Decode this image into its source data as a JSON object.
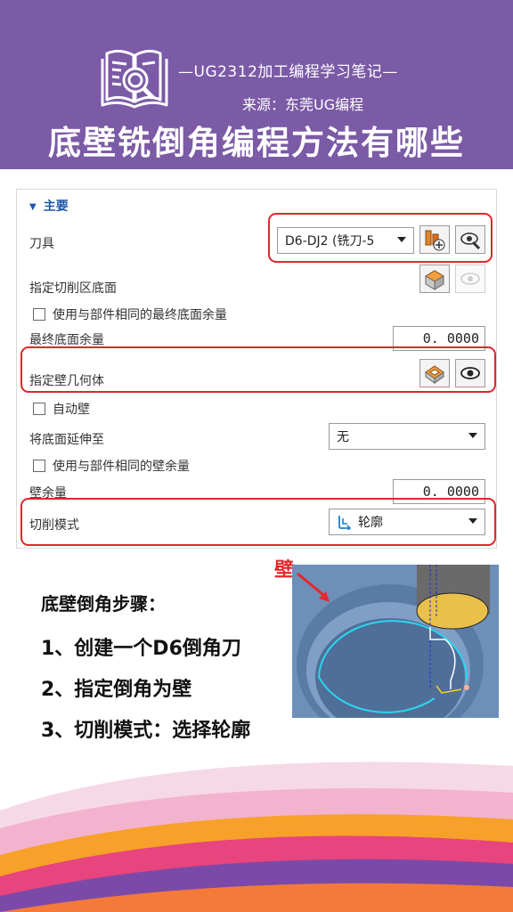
{
  "header": {
    "subtitle": "—UG2312加工编程学习笔记—",
    "source": "来源：东莞UG编程",
    "title": "底壁铣倒角编程方法有哪些"
  },
  "panel": {
    "section": "主要",
    "tool_label": "刀具",
    "tool_value": "D6-DJ2 (铣刀-5",
    "floor_label": "指定切削区底面",
    "floor_stock_cb": "使用与部件相同的最终底面余量",
    "floor_stock_label": "最终底面余量",
    "floor_stock_value": "0. 0000",
    "wall_geom_label": "指定壁几何体",
    "auto_wall_cb": "自动壁",
    "extend_label": "将底面延伸至",
    "extend_value": "无",
    "wall_stock_cb": "使用与部件相同的壁余量",
    "wall_stock_label": "壁余量",
    "wall_stock_value": "0. 0000",
    "cut_mode_label": "切削模式",
    "cut_mode_value": "轮廓"
  },
  "steps": {
    "title": "底壁倒角步骤：",
    "s1": "1、创建一个D6倒角刀",
    "s2": "2、指定倒角为壁",
    "s3": "3、切削模式：选择轮廓"
  },
  "annotation": {
    "wall_label": "壁"
  },
  "colors": {
    "header": "#7b5aa6",
    "highlight": "#e0262b",
    "section": "#1e57a8"
  }
}
